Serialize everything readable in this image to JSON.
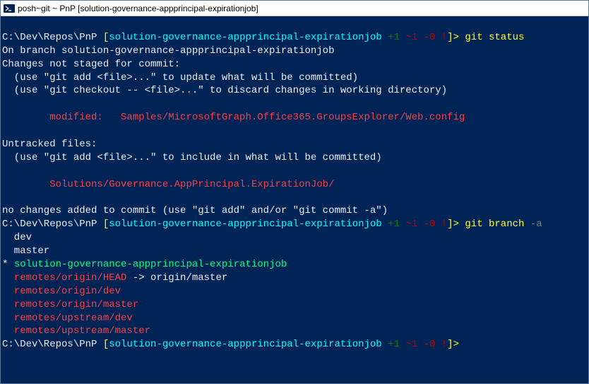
{
  "window_title": "posh~git ~ PnP [solution-governance-appprincipal-expirationjob]",
  "prompt": {
    "path": "C:\\Dev\\Repos\\PnP",
    "open_bracket": "[",
    "branch": "solution-governance-appprincipal-expirationjob",
    "added": "+1",
    "modified": "~1",
    "deleted": "-0",
    "bang": "!",
    "close_bracket": "]>",
    "close_bracket2": "]>"
  },
  "commands": {
    "git_status": "git status",
    "git_branch": "git branch",
    "branch_flag": "-a"
  },
  "status_output": {
    "line1": "On branch solution-governance-appprincipal-expirationjob",
    "line2": "Changes not staged for commit:",
    "line3": "  (use \"git add <file>...\" to update what will be committed)",
    "line4": "  (use \"git checkout -- <file>...\" to discard changes in working directory)",
    "modified_label": "        modified:   ",
    "modified_file": "Samples/MicrosoftGraph.Office365.GroupsExplorer/Web.config",
    "untracked_header": "Untracked files:",
    "untracked_hint": "  (use \"git add <file>...\" to include in what will be committed)",
    "untracked_file": "        Solutions/Governance.AppPrincipal.ExpirationJob/",
    "no_changes": "no changes added to commit (use \"git add\" and/or \"git commit -a\")"
  },
  "branches": {
    "dev": "  dev",
    "master": "  master",
    "current_prefix": "* ",
    "current": "solution-governance-appprincipal-expirationjob",
    "remote_head": "  remotes/origin/HEAD",
    "remote_head_arrow": " -> origin/master",
    "remote_origin_dev": "  remotes/origin/dev",
    "remote_origin_master": "  remotes/origin/master",
    "remote_upstream_dev": "  remotes/upstream/dev",
    "remote_upstream_master": "  remotes/upstream/master"
  }
}
